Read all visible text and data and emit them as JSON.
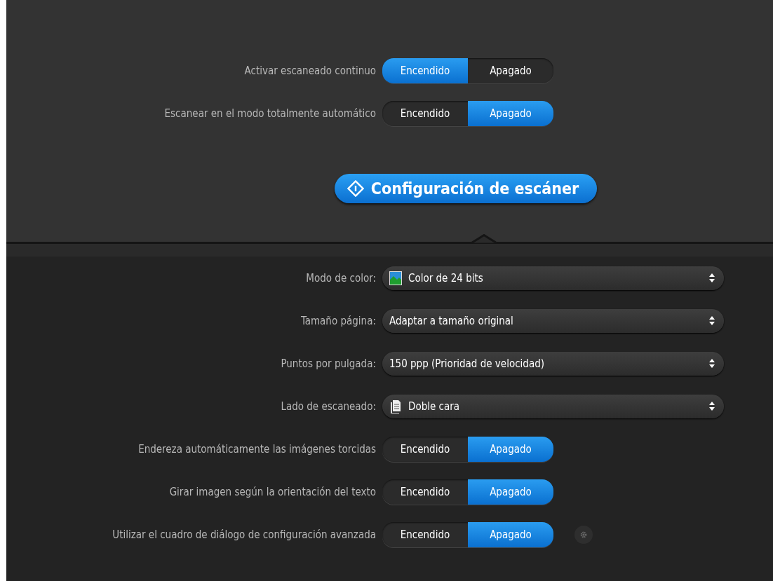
{
  "top_settings": [
    {
      "label": "Activar escaneado continuo",
      "options": [
        {
          "label": "Encendido",
          "selected": true
        },
        {
          "label": "Apagado",
          "selected": false
        }
      ]
    },
    {
      "label": "Escanear en el modo totalmente automático",
      "options": [
        {
          "label": "Encendido",
          "selected": false
        },
        {
          "label": "Apagado",
          "selected": true
        }
      ]
    }
  ],
  "scanner_button": {
    "label": "Configuración de escáner"
  },
  "scanner_settings": [
    {
      "kind": "image-select",
      "label": "Modo de color:",
      "value": "Color de 24 bits"
    },
    {
      "kind": "select",
      "label": "Tamaño página:",
      "value": "Adaptar a tamaño original"
    },
    {
      "kind": "select",
      "label": "Puntos por pulgada:",
      "value": "150 ppp (Prioridad de velocidad)"
    },
    {
      "kind": "page-select",
      "label": "Lado de escaneado:",
      "value": "Doble cara"
    },
    {
      "kind": "toggle",
      "label": "Endereza automáticamente las imágenes torcidas",
      "options": [
        {
          "label": "Encendido",
          "selected": false
        },
        {
          "label": "Apagado",
          "selected": true
        }
      ]
    },
    {
      "kind": "toggle",
      "label": "Girar imagen según la orientación del texto",
      "options": [
        {
          "label": "Encendido",
          "selected": false
        },
        {
          "label": "Apagado",
          "selected": true
        }
      ]
    },
    {
      "kind": "toggle-gear",
      "label": "Utilizar el cuadro de diálogo de configuración avanzada",
      "options": [
        {
          "label": "Encendido",
          "selected": false
        },
        {
          "label": "Apagado",
          "selected": true
        }
      ]
    }
  ]
}
